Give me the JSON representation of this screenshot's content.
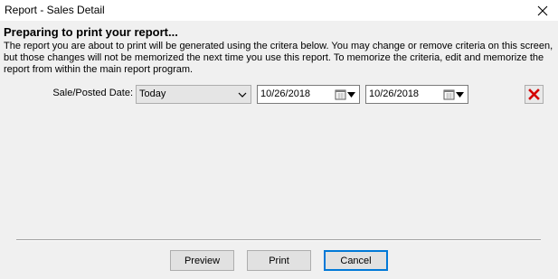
{
  "window": {
    "title": "Report - Sales Detail",
    "close_icon": "close-icon"
  },
  "content": {
    "heading": "Preparing to print your report...",
    "description": "The report you are about to print will be generated using the critera below. You may change or remove criteria on this screen, but those changes will not be memorized the next time you use this report.  To memorize the criteria, edit and memorize the report from within the main report program."
  },
  "criteria": {
    "label": "Sale/Posted Date:",
    "range_value": "Today",
    "start_date": "10/26/2018",
    "end_date": "10/26/2018",
    "remove_color": "#d40000"
  },
  "buttons": {
    "preview": "Preview",
    "print": "Print",
    "cancel": "Cancel"
  }
}
